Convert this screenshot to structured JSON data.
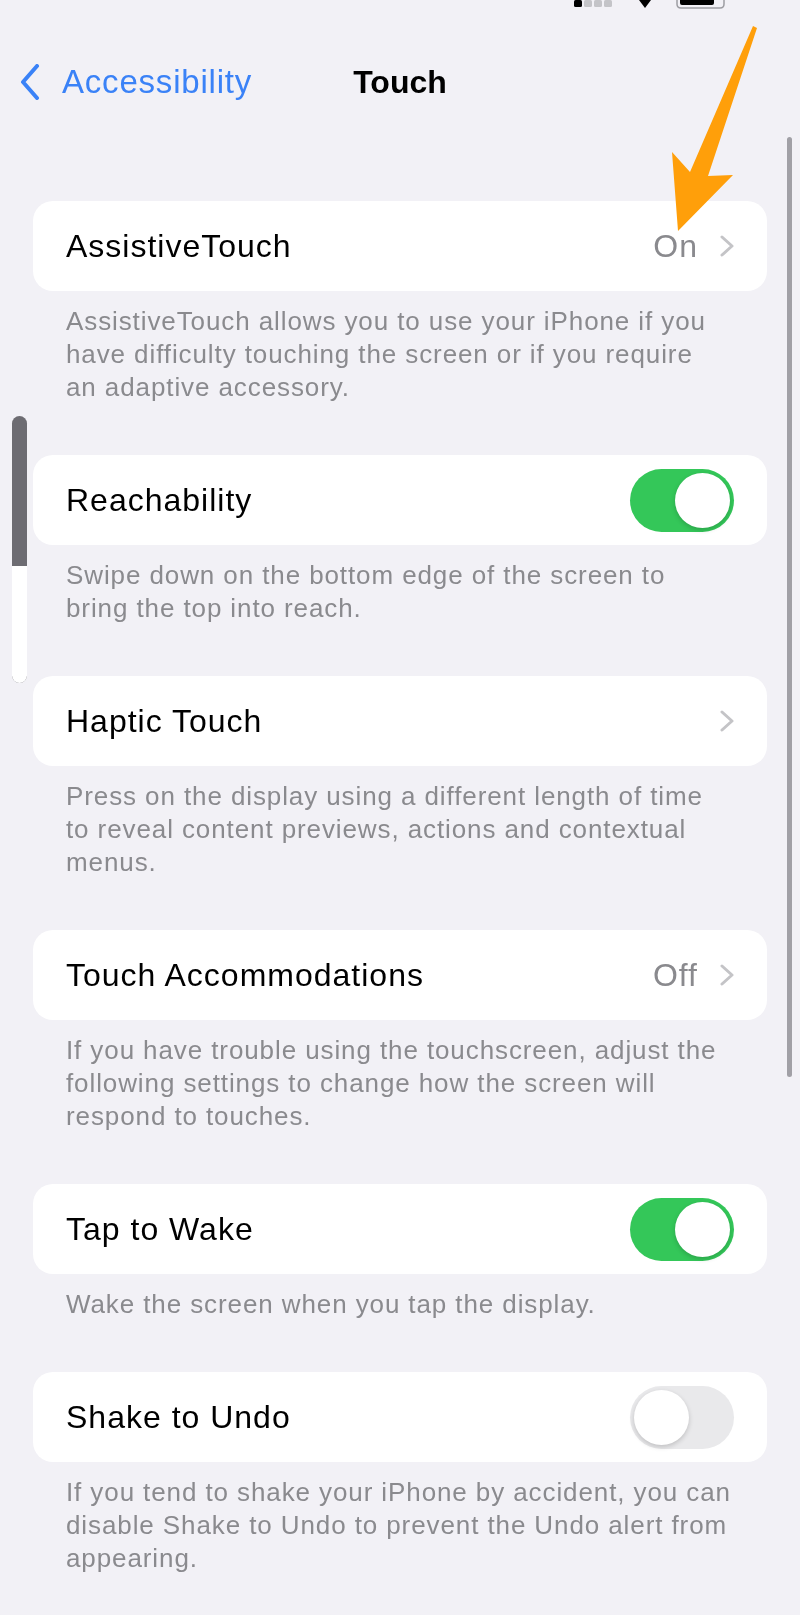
{
  "nav_bar": {
    "back_label": "Accessibility",
    "title": "Touch"
  },
  "volume_indicator": {
    "level": 0.44
  },
  "sections": [
    {
      "kind": "link",
      "label": "AssistiveTouch",
      "value": "On",
      "footer": "AssistiveTouch allows you to use your iPhone if you have difficulty touching the screen or if you require an adaptive accessory."
    },
    {
      "kind": "toggle",
      "label": "Reachability",
      "on": true,
      "footer": "Swipe down on the bottom edge of the screen to bring the top into reach."
    },
    {
      "kind": "link",
      "label": "Haptic Touch",
      "footer": "Press on the display using a different length of time to reveal content previews, actions and contextual menus."
    },
    {
      "kind": "link",
      "label": "Touch Accommodations",
      "value": "Off",
      "footer": "If you have trouble using the touchscreen, adjust the following settings to change how the screen will respond to touches."
    },
    {
      "kind": "toggle",
      "label": "Tap to Wake",
      "on": true,
      "footer": "Wake the screen when you tap the display."
    },
    {
      "kind": "toggle",
      "label": "Shake to Undo",
      "on": false,
      "footer": "If you tend to shake your iPhone by accident, you can disable Shake to Undo to prevent the Undo alert from appearing."
    }
  ]
}
